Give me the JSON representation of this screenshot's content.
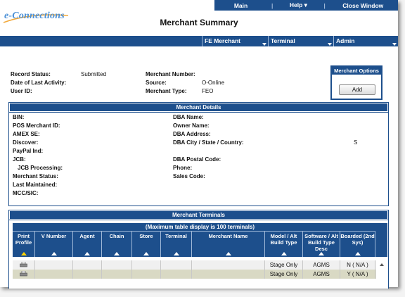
{
  "topnav": {
    "main": "Main",
    "help": "Help",
    "close": "Close Window",
    "sep": "|"
  },
  "brand": {
    "logo_text": "e-Connections"
  },
  "page_title": "Merchant Summary",
  "tabs": [
    "FE Merchant",
    "Terminal",
    "Admin"
  ],
  "summary": {
    "record_status_label": "Record Status:",
    "record_status_value": "Submitted",
    "last_activity_label": "Date of Last Activity:",
    "user_id_label": "User ID:",
    "merchant_number_label": "Merchant Number:",
    "source_label": "Source:",
    "source_value": "O-Online",
    "merchant_type_label": "Merchant Type:",
    "merchant_type_value": "FEO"
  },
  "options": {
    "title": "Merchant Options",
    "add_label": "Add"
  },
  "details": {
    "title": "Merchant Details",
    "left": [
      "BIN:",
      "POS Merchant ID:",
      "AMEX SE:",
      "Discover:",
      "PayPal Ind:",
      "JCB:",
      "JCB Processing:",
      "Merchant Status:",
      "Last Maintained:",
      "MCC/SIC:"
    ],
    "right": [
      "DBA Name:",
      "Owner Name:",
      "DBA Address:",
      "DBA City / State / Country:",
      "DBA Postal Code:",
      "Phone:",
      "Sales Code:"
    ],
    "city_value": "S"
  },
  "terminals": {
    "title": "Merchant Terminals",
    "caption": "(Maximum table display is 100 terminals)",
    "columns": [
      "Print Profile",
      "V Number",
      "Agent",
      "Chain",
      "Store",
      "Terminal",
      "Merchant Name",
      "Model / Alt Build Type",
      "Software / Alt Build Type Desc",
      "Boarded (2nd Sys)"
    ],
    "rows": [
      {
        "model": "Stage Only",
        "software": "AGMS",
        "boarded": "N ( N/A )"
      },
      {
        "model": "Stage Only",
        "software": "AGMS",
        "boarded": "Y ( N/A )"
      }
    ]
  },
  "colors": {
    "navy": "#1d4f8c",
    "logo_blue": "#4a8fd6",
    "sort_arrow": "#ffd400"
  }
}
